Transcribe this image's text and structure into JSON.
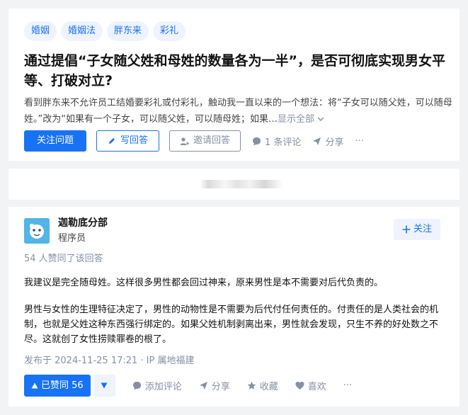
{
  "question": {
    "tags": [
      "婚姻",
      "婚姻法",
      "胖东来",
      "彩礼"
    ],
    "title": "通过提倡“子女随父姓和母姓的数量各为一半”，是否可彻底实现男女平等、打破对立?",
    "description": "看到胖东来不允许员工结婚要彩礼或付彩礼，触动我一直以来的一个想法：将“子女可以随父姓，可以随母姓。”改为“如果有一个子女，可以随父姓，可以随母姓；如果…",
    "show_all": "显示全部",
    "actions": {
      "follow": "关注问题",
      "write_answer": "写回答",
      "invite": "邀请回答",
      "comments": "1 条评论",
      "share": "分享",
      "more": "···"
    }
  },
  "answer": {
    "author_name": "迦勒底分部",
    "author_role": "程序员",
    "follow_label": "关注",
    "agree_count_text": "54 人赞同了该回答",
    "paragraphs": [
      "我建议是完全随母姓。这样很多男性都会回过神来，原来男性是本不需要对后代负责的。",
      "男性与女性的生理特征决定了，男性的动物性是不需要为后代付任何责任的。付责任的是人类社会的机制，也就是父姓这种东西强行绑定的。如果父姓机制剥离出来，男性就会发现，只生不养的好处数之不尽。这就创了女性捞赎罪卷的根了。"
    ],
    "publish_info": "发布于 2024-11-25 17:21 · IP 属地福建",
    "actions": {
      "upvote": "已赞同 56",
      "add_comment": "添加评论",
      "share": "分享",
      "collect": "收藏",
      "like": "喜欢",
      "more": "···"
    }
  },
  "colors": {
    "brand_blue": "#1772f6",
    "tag_bg": "#eef3fe",
    "meta_gray": "#8590a6",
    "avatar_bg": "#52b4e7"
  }
}
